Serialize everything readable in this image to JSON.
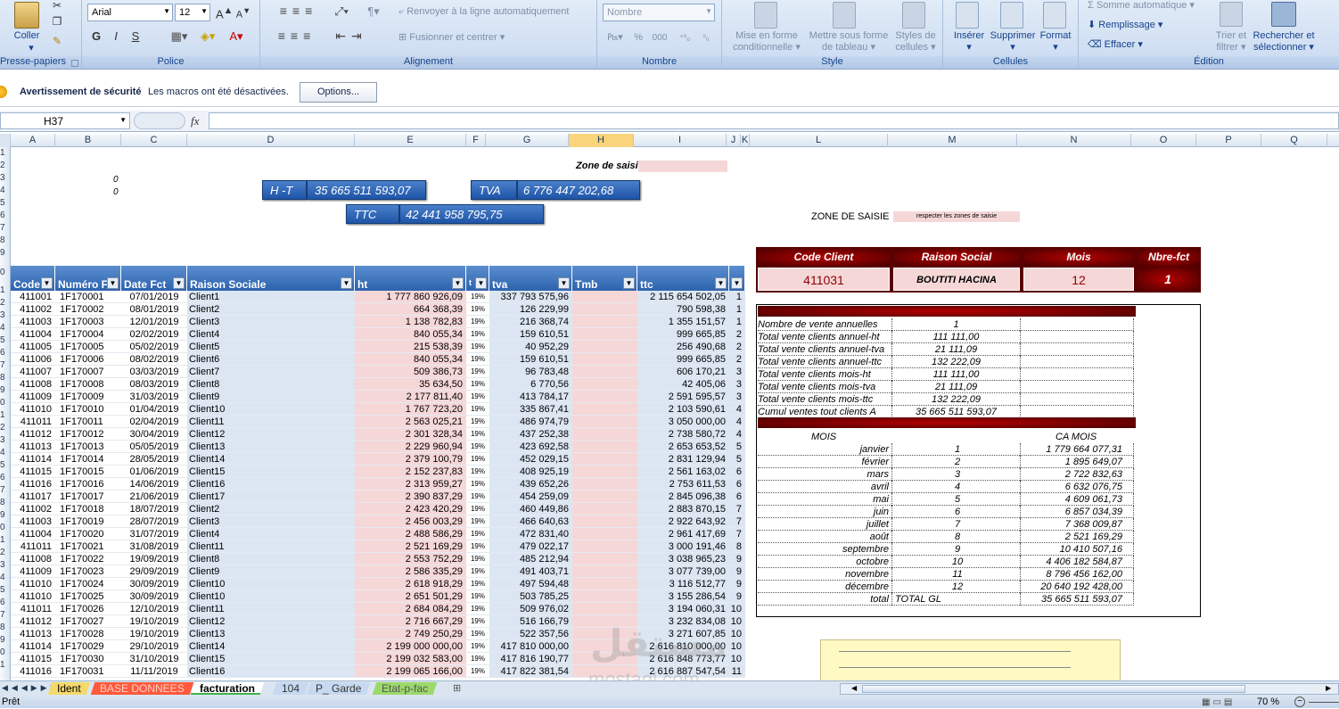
{
  "ribbon": {
    "coller": "Coller",
    "presse": "Presse-papiers",
    "police": "Police",
    "alignement": "Alignement",
    "nombre": "Nombre",
    "style": "Style",
    "cellules": "Cellules",
    "edition": "Édition",
    "font_name": "Arial",
    "font_size": "12",
    "renvoyer": "Renvoyer à la ligne automatiquement",
    "fusionner": "Fusionner et centrer",
    "format_nombre": "Nombre",
    "mise_forme": "Mise en forme conditionnelle",
    "mettre_tableau": "Mettre sous forme de tableau",
    "styles_cellules": "Styles de cellules",
    "inserer": "Insérer",
    "supprimer": "Supprimer",
    "format": "Format",
    "somme": "Somme automatique",
    "remplissage": "Remplissage",
    "effacer": "Effacer",
    "trier": "Trier et filtrer",
    "rechercher": "Rechercher et sélectionner",
    "bold": "G",
    "italic": "I",
    "underline": "S",
    "pct": "%",
    "thousands": "000"
  },
  "security": {
    "title": "Avertissement de sécurité",
    "message": "Les macros ont été désactivées.",
    "button": "Options..."
  },
  "formula": {
    "namebox": "H37",
    "fx": "fx",
    "value": ""
  },
  "columns": [
    "A",
    "B",
    "C",
    "D",
    "E",
    "F",
    "G",
    "H",
    "I",
    "J",
    "K",
    "L",
    "M",
    "N",
    "O",
    "P",
    "Q"
  ],
  "rows": [
    "1",
    "2",
    "3",
    "4",
    "5",
    "6",
    "7",
    "8",
    "9",
    "0",
    "1",
    "2",
    "3",
    "4",
    "5",
    "6",
    "7",
    "8",
    "9",
    "0",
    "1",
    "2",
    "3",
    "4",
    "5",
    "6",
    "7",
    "8",
    "9",
    "0",
    "1",
    "2",
    "3",
    "4",
    "5",
    "6",
    "7",
    "8",
    "9",
    "0",
    "1"
  ],
  "sheet": {
    "zone_saisie": "Zone de saisie",
    "zero1": "0",
    "zero2": "0",
    "ht_label": "H -T",
    "ht_value": "35 665 511 593,07",
    "tva_label": "TVA",
    "tva_value": "6 776 447 202,68",
    "ttc_label": "TTC",
    "ttc_value": "42 441 958 795,75",
    "zone_saisie2": "ZONE DE SAISIE",
    "respecter": "respecter les zones de saisie",
    "headers": [
      "Code",
      "Numéro F",
      "Date Fct",
      "Raison Sociale",
      "ht",
      "t",
      "tva",
      "Tmb",
      "ttc",
      ""
    ],
    "rows": [
      [
        "411001",
        "1F170001",
        "07/01/2019",
        "Client1",
        "1 777 860 926,09",
        "19%",
        "337 793 575,96",
        "",
        "2 115 654 502,05",
        "1"
      ],
      [
        "411002",
        "1F170002",
        "08/01/2019",
        "Client2",
        "664 368,39",
        "19%",
        "126 229,99",
        "",
        "790 598,38",
        "1"
      ],
      [
        "411003",
        "1F170003",
        "12/01/2019",
        "Client3",
        "1 138 782,83",
        "19%",
        "216 368,74",
        "",
        "1 355 151,57",
        "1"
      ],
      [
        "411004",
        "1F170004",
        "02/02/2019",
        "Client4",
        "840 055,34",
        "19%",
        "159 610,51",
        "",
        "999 665,85",
        "2"
      ],
      [
        "411005",
        "1F170005",
        "05/02/2019",
        "Client5",
        "215 538,39",
        "19%",
        "40 952,29",
        "",
        "256 490,68",
        "2"
      ],
      [
        "411006",
        "1F170006",
        "08/02/2019",
        "Client6",
        "840 055,34",
        "19%",
        "159 610,51",
        "",
        "999 665,85",
        "2"
      ],
      [
        "411007",
        "1F170007",
        "03/03/2019",
        "Client7",
        "509 386,73",
        "19%",
        "96 783,48",
        "",
        "606 170,21",
        "3"
      ],
      [
        "411008",
        "1F170008",
        "08/03/2019",
        "Client8",
        "35 634,50",
        "19%",
        "6 770,56",
        "",
        "42 405,06",
        "3"
      ],
      [
        "411009",
        "1F170009",
        "31/03/2019",
        "Client9",
        "2 177 811,40",
        "19%",
        "413 784,17",
        "",
        "2 591 595,57",
        "3"
      ],
      [
        "411010",
        "1F170010",
        "01/04/2019",
        "Client10",
        "1 767 723,20",
        "19%",
        "335 867,41",
        "",
        "2 103 590,61",
        "4"
      ],
      [
        "411011",
        "1F170011",
        "02/04/2019",
        "Client11",
        "2 563 025,21",
        "19%",
        "486 974,79",
        "",
        "3 050 000,00",
        "4"
      ],
      [
        "411012",
        "1F170012",
        "30/04/2019",
        "Client12",
        "2 301 328,34",
        "19%",
        "437 252,38",
        "",
        "2 738 580,72",
        "4"
      ],
      [
        "411013",
        "1F170013",
        "05/05/2019",
        "Client13",
        "2 229 960,94",
        "19%",
        "423 692,58",
        "",
        "2 653 653,52",
        "5"
      ],
      [
        "411014",
        "1F170014",
        "28/05/2019",
        "Client14",
        "2 379 100,79",
        "19%",
        "452 029,15",
        "",
        "2 831 129,94",
        "5"
      ],
      [
        "411015",
        "1F170015",
        "01/06/2019",
        "Client15",
        "2 152 237,83",
        "19%",
        "408 925,19",
        "",
        "2 561 163,02",
        "6"
      ],
      [
        "411016",
        "1F170016",
        "14/06/2019",
        "Client16",
        "2 313 959,27",
        "19%",
        "439 652,26",
        "",
        "2 753 611,53",
        "6"
      ],
      [
        "411017",
        "1F170017",
        "21/06/2019",
        "Client17",
        "2 390 837,29",
        "19%",
        "454 259,09",
        "",
        "2 845 096,38",
        "6"
      ],
      [
        "411002",
        "1F170018",
        "18/07/2019",
        "Client2",
        "2 423 420,29",
        "19%",
        "460 449,86",
        "",
        "2 883 870,15",
        "7"
      ],
      [
        "411003",
        "1F170019",
        "28/07/2019",
        "Client3",
        "2 456 003,29",
        "19%",
        "466 640,63",
        "",
        "2 922 643,92",
        "7"
      ],
      [
        "411004",
        "1F170020",
        "31/07/2019",
        "Client4",
        "2 488 586,29",
        "19%",
        "472 831,40",
        "",
        "2 961 417,69",
        "7"
      ],
      [
        "411011",
        "1F170021",
        "31/08/2019",
        "Client11",
        "2 521 169,29",
        "19%",
        "479 022,17",
        "",
        "3 000 191,46",
        "8"
      ],
      [
        "411008",
        "1F170022",
        "19/09/2019",
        "Client8",
        "2 553 752,29",
        "19%",
        "485 212,94",
        "",
        "3 038 965,23",
        "9"
      ],
      [
        "411009",
        "1F170023",
        "29/09/2019",
        "Client9",
        "2 586 335,29",
        "19%",
        "491 403,71",
        "",
        "3 077 739,00",
        "9"
      ],
      [
        "411010",
        "1F170024",
        "30/09/2019",
        "Client10",
        "2 618 918,29",
        "19%",
        "497 594,48",
        "",
        "3 116 512,77",
        "9"
      ],
      [
        "411010",
        "1F170025",
        "30/09/2019",
        "Client10",
        "2 651 501,29",
        "19%",
        "503 785,25",
        "",
        "3 155 286,54",
        "9"
      ],
      [
        "411011",
        "1F170026",
        "12/10/2019",
        "Client11",
        "2 684 084,29",
        "19%",
        "509 976,02",
        "",
        "3 194 060,31",
        "10"
      ],
      [
        "411012",
        "1F170027",
        "19/10/2019",
        "Client12",
        "2 716 667,29",
        "19%",
        "516 166,79",
        "",
        "3 232 834,08",
        "10"
      ],
      [
        "411013",
        "1F170028",
        "19/10/2019",
        "Client13",
        "2 749 250,29",
        "19%",
        "522 357,56",
        "",
        "3 271 607,85",
        "10"
      ],
      [
        "411014",
        "1F170029",
        "29/10/2019",
        "Client14",
        "2 199 000 000,00",
        "19%",
        "417 810 000,00",
        "",
        "2 616 810 000,00",
        "10"
      ],
      [
        "411015",
        "1F170030",
        "31/10/2019",
        "Client15",
        "2 199 032 583,00",
        "19%",
        "417 816 190,77",
        "",
        "2 616 848 773,77",
        "10"
      ],
      [
        "411016",
        "1F170031",
        "11/11/2019",
        "Client16",
        "2 199 065 166,00",
        "19%",
        "417 822 381,54",
        "",
        "2 616 887 547,54",
        "11"
      ]
    ],
    "client_head": [
      "Code Client",
      "Raison Social",
      "Mois",
      "Nbre-fct"
    ],
    "client_vals": [
      "411031",
      "BOUTITI HACINA",
      "12",
      "1"
    ],
    "stats": [
      [
        "Nombre de vente annuelles",
        "1"
      ],
      [
        "Total vente clients annuel-ht",
        "111 111,00"
      ],
      [
        "Total vente clients annuel-tva",
        "21 111,09"
      ],
      [
        "Total vente clients annuel-ttc",
        "132 222,09"
      ],
      [
        "Total vente clients mois-ht",
        "111 111,00"
      ],
      [
        "Total vente clients mois-tva",
        "21 111,09"
      ],
      [
        "Total vente clients mois-ttc",
        "132 222,09"
      ],
      [
        "Cumul ventes tout clients A",
        "35 665 511 593,07"
      ]
    ],
    "mois_head": "MOIS",
    "ca_head": "CA MOIS",
    "months": [
      [
        "janvier",
        "1",
        "1 779 664 077,31"
      ],
      [
        "février",
        "2",
        "1 895 649,07"
      ],
      [
        "mars",
        "3",
        "2 722 832,63"
      ],
      [
        "avril",
        "4",
        "6 632 076,75"
      ],
      [
        "mai",
        "5",
        "4 609 061,73"
      ],
      [
        "juin",
        "6",
        "6 857 034,39"
      ],
      [
        "juillet",
        "7",
        "7 368 009,87"
      ],
      [
        "août",
        "8",
        "2 521 169,29"
      ],
      [
        "septembre",
        "9",
        "10 410 507,16"
      ],
      [
        "octobre",
        "10",
        "4 406 182 584,87"
      ],
      [
        "novembre",
        "11",
        "8 796 456 162,00"
      ],
      [
        "décembre",
        "12",
        "20 640 192 428,00"
      ],
      [
        "total",
        "TOTAL GL",
        "35 665 511 593,07"
      ]
    ]
  },
  "tabs": [
    "Ident",
    "BASE DONNEES",
    "facturation",
    "104",
    "P_ Garde",
    "Etat-p-fac"
  ],
  "status": {
    "ready": "Prêt",
    "zoom": "70 %"
  },
  "watermark": "mostaql.com",
  "colors": {
    "blue_kpi": "#2d62ae",
    "dark_red": "#8b0000",
    "pink": "#f6d7d8",
    "light_blue_col": "#dce6f2",
    "yellow_note": "#fff9c4"
  }
}
